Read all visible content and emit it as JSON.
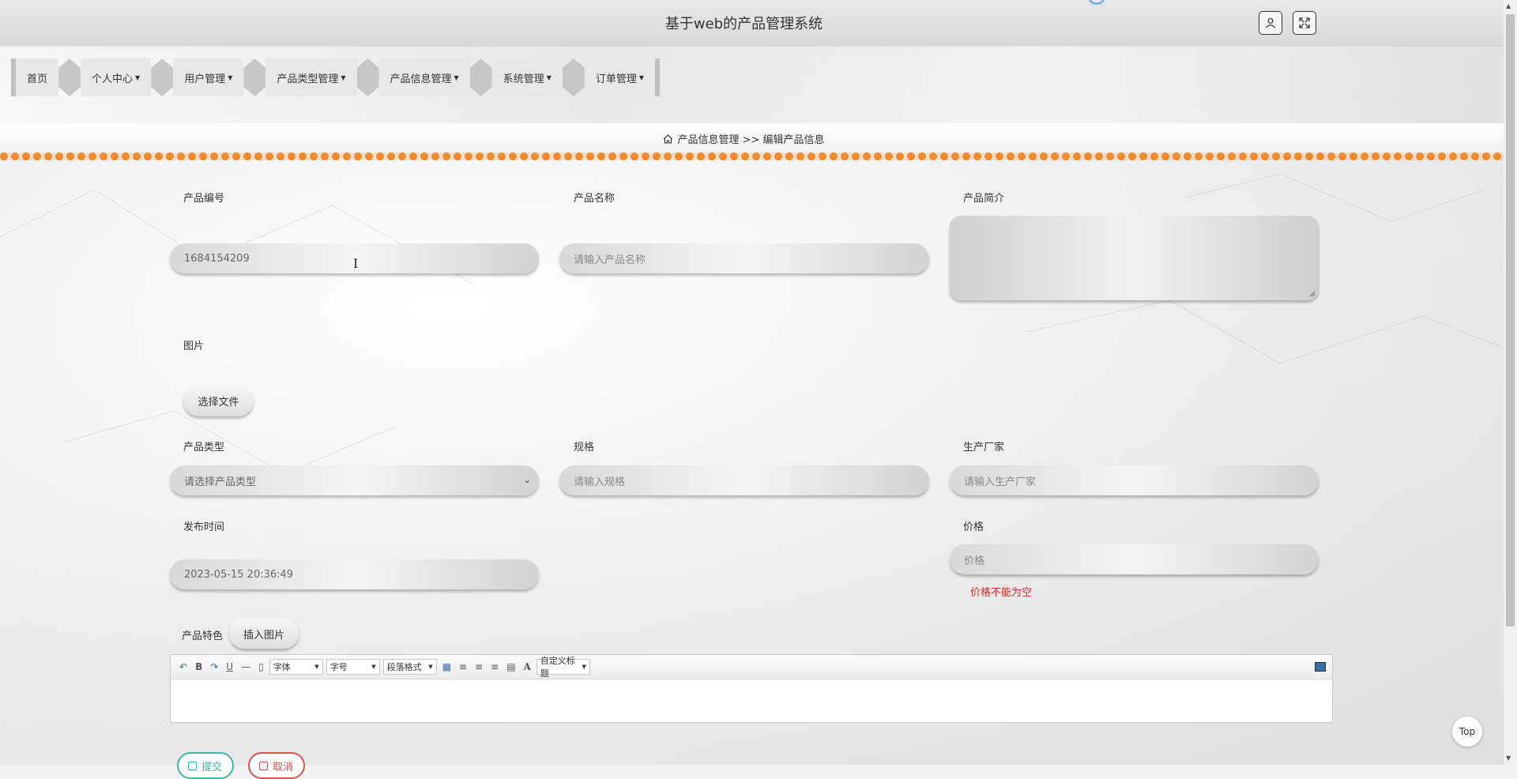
{
  "header": {
    "title": "基于web的产品管理系统"
  },
  "nav": [
    {
      "label": "首页",
      "dropdown": false
    },
    {
      "label": "个人中心",
      "dropdown": true
    },
    {
      "label": "用户管理",
      "dropdown": true
    },
    {
      "label": "产品类型管理",
      "dropdown": true
    },
    {
      "label": "产品信息管理",
      "dropdown": true
    },
    {
      "label": "系统管理",
      "dropdown": true
    },
    {
      "label": "订单管理",
      "dropdown": true
    }
  ],
  "breadcrumb": {
    "text": "产品信息管理 >> 编辑产品信息"
  },
  "form": {
    "product_no": {
      "label": "产品编号",
      "value": "1684154209"
    },
    "product_name": {
      "label": "产品名称",
      "placeholder": "请输入产品名称"
    },
    "product_intro": {
      "label": "产品简介"
    },
    "image": {
      "label": "图片",
      "button": "选择文件"
    },
    "product_type": {
      "label": "产品类型",
      "placeholder": "请选择产品类型"
    },
    "spec": {
      "label": "规格",
      "placeholder": "请输入规格"
    },
    "manufacturer": {
      "label": "生产厂家",
      "placeholder": "请输入生产厂家"
    },
    "publish_time": {
      "label": "发布时间",
      "value": "2023-05-15 20:36:49"
    },
    "price": {
      "label": "价格",
      "placeholder": "价格",
      "error": "价格不能为空"
    },
    "feature": {
      "label": "产品特色",
      "insert_button": "插入图片"
    }
  },
  "editor_toolbar": {
    "font": "字体",
    "size": "字号",
    "paragraph": "段落格式",
    "custom_title": "自定义标题",
    "bold": "B",
    "underline": "U",
    "font_color": "A"
  },
  "actions": {
    "submit": "提交",
    "cancel": "取消"
  },
  "top_button": "Top",
  "colors": {
    "accent_orange": "#f08a2c",
    "error_red": "#d13030",
    "submit_green": "#3bb8a0",
    "cancel_red": "#d9534f"
  }
}
